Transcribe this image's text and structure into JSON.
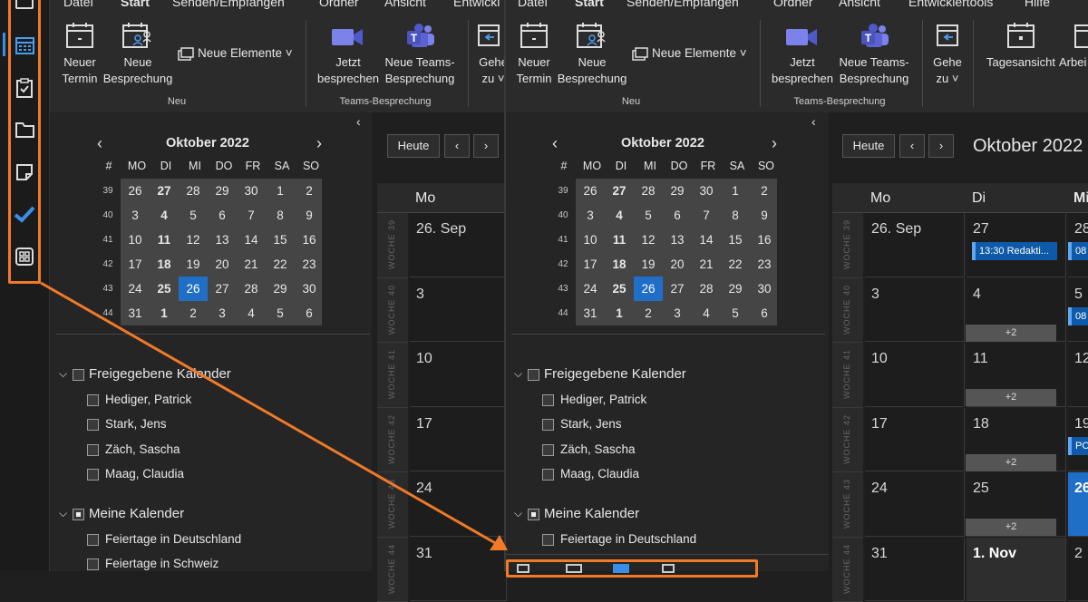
{
  "left": {
    "tabs": [
      "Datei",
      "Start",
      "Senden/Empfangen",
      "Ordner",
      "Ansicht",
      "Entwickl"
    ],
    "ribbon": {
      "new_appointment": "Neuer\nTermin",
      "new_meeting": "Neue\nBesprechung",
      "new_items": "Neue Elemente ˅",
      "group_new": "Neu",
      "meet_now": "Jetzt\nbesprechen",
      "new_teams_meeting": "Neue Teams-\nBesprechung",
      "group_teams": "Teams-Besprechung",
      "goto": "Gehe\nzu ˅"
    },
    "minical": {
      "month": "Oktober 2022",
      "weekday_header": [
        "#",
        "MO",
        "DI",
        "MI",
        "DO",
        "FR",
        "SA",
        "SO"
      ],
      "weeks": [
        {
          "wk": "39",
          "days": [
            "26",
            "27",
            "28",
            "29",
            "30",
            "1",
            "2"
          ]
        },
        {
          "wk": "40",
          "days": [
            "3",
            "4",
            "5",
            "6",
            "7",
            "8",
            "9"
          ]
        },
        {
          "wk": "41",
          "days": [
            "10",
            "11",
            "12",
            "13",
            "14",
            "15",
            "16"
          ]
        },
        {
          "wk": "42",
          "days": [
            "17",
            "18",
            "19",
            "20",
            "21",
            "22",
            "23"
          ]
        },
        {
          "wk": "43",
          "days": [
            "24",
            "25",
            "26",
            "27",
            "28",
            "29",
            "30"
          ]
        },
        {
          "wk": "44",
          "days": [
            "31",
            "1",
            "2",
            "3",
            "4",
            "5",
            "6"
          ]
        }
      ]
    },
    "shared_group": "Freigegebene Kalender",
    "shared_calendars": [
      "Hediger, Patrick",
      "Stark, Jens",
      "Zäch, Sascha",
      "Maag, Claudia"
    ],
    "my_group": "Meine Kalender",
    "my_calendars": [
      "Feiertage in Deutschland",
      "Feiertage in Schweiz"
    ],
    "today_btn": "Heute",
    "col_day": "Mo",
    "week_labels": [
      "WOCHE 39",
      "WOCHE 40",
      "WOCHE 41",
      "WOCHE 42",
      "WOCHE 43",
      "WOCHE 44"
    ],
    "mon_dates": [
      "26. Sep",
      "3",
      "10",
      "17",
      "24",
      "31"
    ]
  },
  "right": {
    "tabs": [
      "Datei",
      "Start",
      "Senden/Empfangen",
      "Ordner",
      "Ansicht",
      "Entwicklertools",
      "Hilfe"
    ],
    "ribbon": {
      "new_appointment": "Neuer\nTermin",
      "new_meeting": "Neue\nBesprechung",
      "new_items": "Neue Elemente ˅",
      "group_new": "Neu",
      "meet_now": "Jetzt\nbesprechen",
      "new_teams_meeting": "Neue Teams-\nBesprechung",
      "group_teams": "Teams-Besprechung",
      "goto": "Gehe\nzu ˅",
      "day_view": "Tagesansicht",
      "work_week": "Arbei"
    },
    "minical": {
      "month": "Oktober 2022"
    },
    "shared_group": "Freigegebene Kalender",
    "shared_calendars": [
      "Hediger, Patrick",
      "Stark, Jens",
      "Zäch, Sascha",
      "Maag, Claudia"
    ],
    "my_group": "Meine Kalender",
    "my_calendars": [
      "Feiertage in Deutschland"
    ],
    "today_btn": "Heute",
    "month_title": "Oktober 2022",
    "col_days": [
      "Mo",
      "Di",
      "Mi"
    ],
    "week_labels": [
      "WOCHE 39",
      "WOCHE 40",
      "WOCHE 41",
      "WOCHE 42",
      "WOCHE 43",
      "WOCHE 44"
    ],
    "mon_dates": [
      "26. Sep",
      "3",
      "10",
      "17",
      "24",
      "31"
    ],
    "tue_dates": [
      "27",
      "4",
      "11",
      "18",
      "25",
      "1. Nov"
    ],
    "wed_dates": [
      "28",
      "5",
      "12",
      "19",
      "26",
      "2"
    ],
    "event_tue": "13:30 Redakti...",
    "event_wed1": "08",
    "event_wed2": "08",
    "event_wed4": "PC",
    "more": "+2"
  },
  "accent": "#f07a28"
}
